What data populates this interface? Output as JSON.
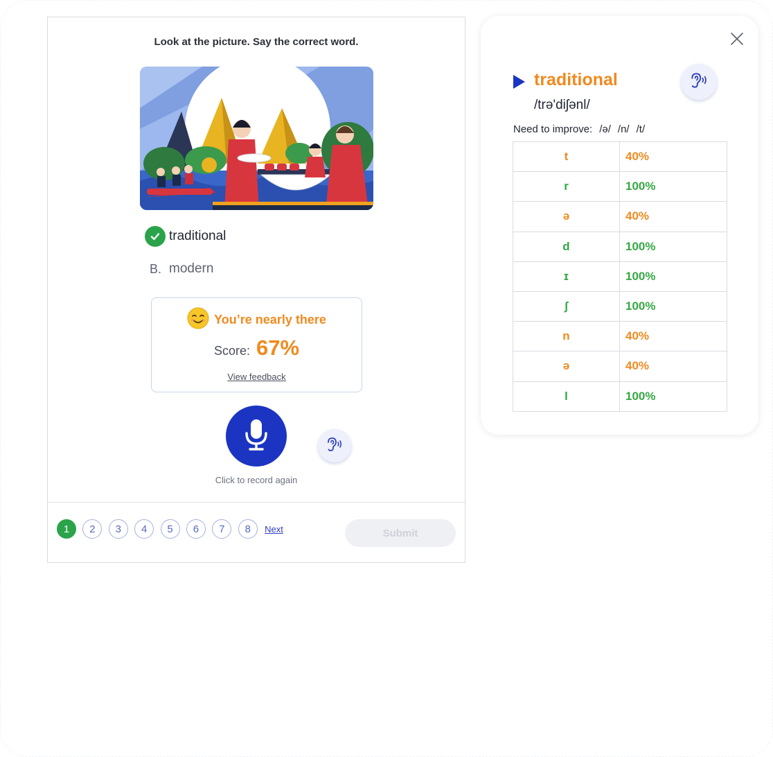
{
  "exercise": {
    "instruction": "Look at the picture. Say the correct word.",
    "options": [
      {
        "label": "",
        "text": "traditional",
        "status": "correct"
      },
      {
        "label": "B.",
        "text": "modern",
        "status": "unselected"
      }
    ],
    "result": {
      "title": "You’re nearly there",
      "score_label": "Score:",
      "score_value": "67%",
      "feedback_link": "View feedback"
    },
    "record_caption": "Click to record again",
    "pagination": {
      "pages": [
        "1",
        "2",
        "3",
        "4",
        "5",
        "6",
        "7",
        "8"
      ],
      "current": "1",
      "next_label": "Next"
    },
    "submit_label": "Submit"
  },
  "feedback": {
    "word": "traditional",
    "phonetic": "/trə'diʃənl/",
    "improve_label": "Need to improve:",
    "improve_phonemes": [
      "/ə/",
      "/n/",
      "/t/"
    ],
    "phonemes": [
      {
        "symbol": "t",
        "score": "40%",
        "level": "bad"
      },
      {
        "symbol": "r",
        "score": "100%",
        "level": "good"
      },
      {
        "symbol": "ə",
        "score": "40%",
        "level": "bad"
      },
      {
        "symbol": "d",
        "score": "100%",
        "level": "good"
      },
      {
        "symbol": "ɪ",
        "score": "100%",
        "level": "good"
      },
      {
        "symbol": "ʃ",
        "score": "100%",
        "level": "good"
      },
      {
        "symbol": "n",
        "score": "40%",
        "level": "bad"
      },
      {
        "symbol": "ə",
        "score": "40%",
        "level": "bad"
      },
      {
        "symbol": "l",
        "score": "100%",
        "level": "good"
      }
    ]
  },
  "colors": {
    "accent_orange": "#f08a1f",
    "success_green": "#2aa34a",
    "mic_blue": "#1b35c2",
    "link_blue": "#2f3fbf"
  },
  "icons": {
    "check": "check-icon",
    "emoji": "smiling-face-icon",
    "mic": "microphone-icon",
    "listen": "ear-sound-icon",
    "play": "play-icon",
    "close": "close-icon"
  }
}
